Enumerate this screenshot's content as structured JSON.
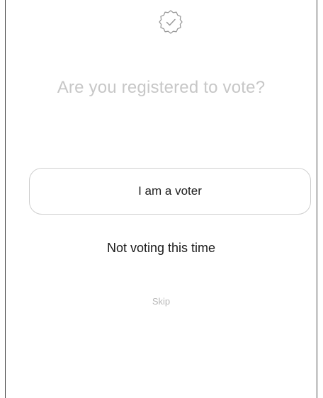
{
  "icons": {
    "header_icon": "check-badge-icon"
  },
  "question": {
    "title": "Are you registered to vote?"
  },
  "options": {
    "voter_label": "I am a voter",
    "not_voting_label": "Not voting this time",
    "skip_label": "Skip"
  },
  "colors": {
    "title": "#c7c7c7",
    "button_border": "#cfcfcf",
    "primary_text": "#1a1a1a",
    "skip_text": "#b8b8b8",
    "icon_stroke": "#9a9a9a"
  }
}
